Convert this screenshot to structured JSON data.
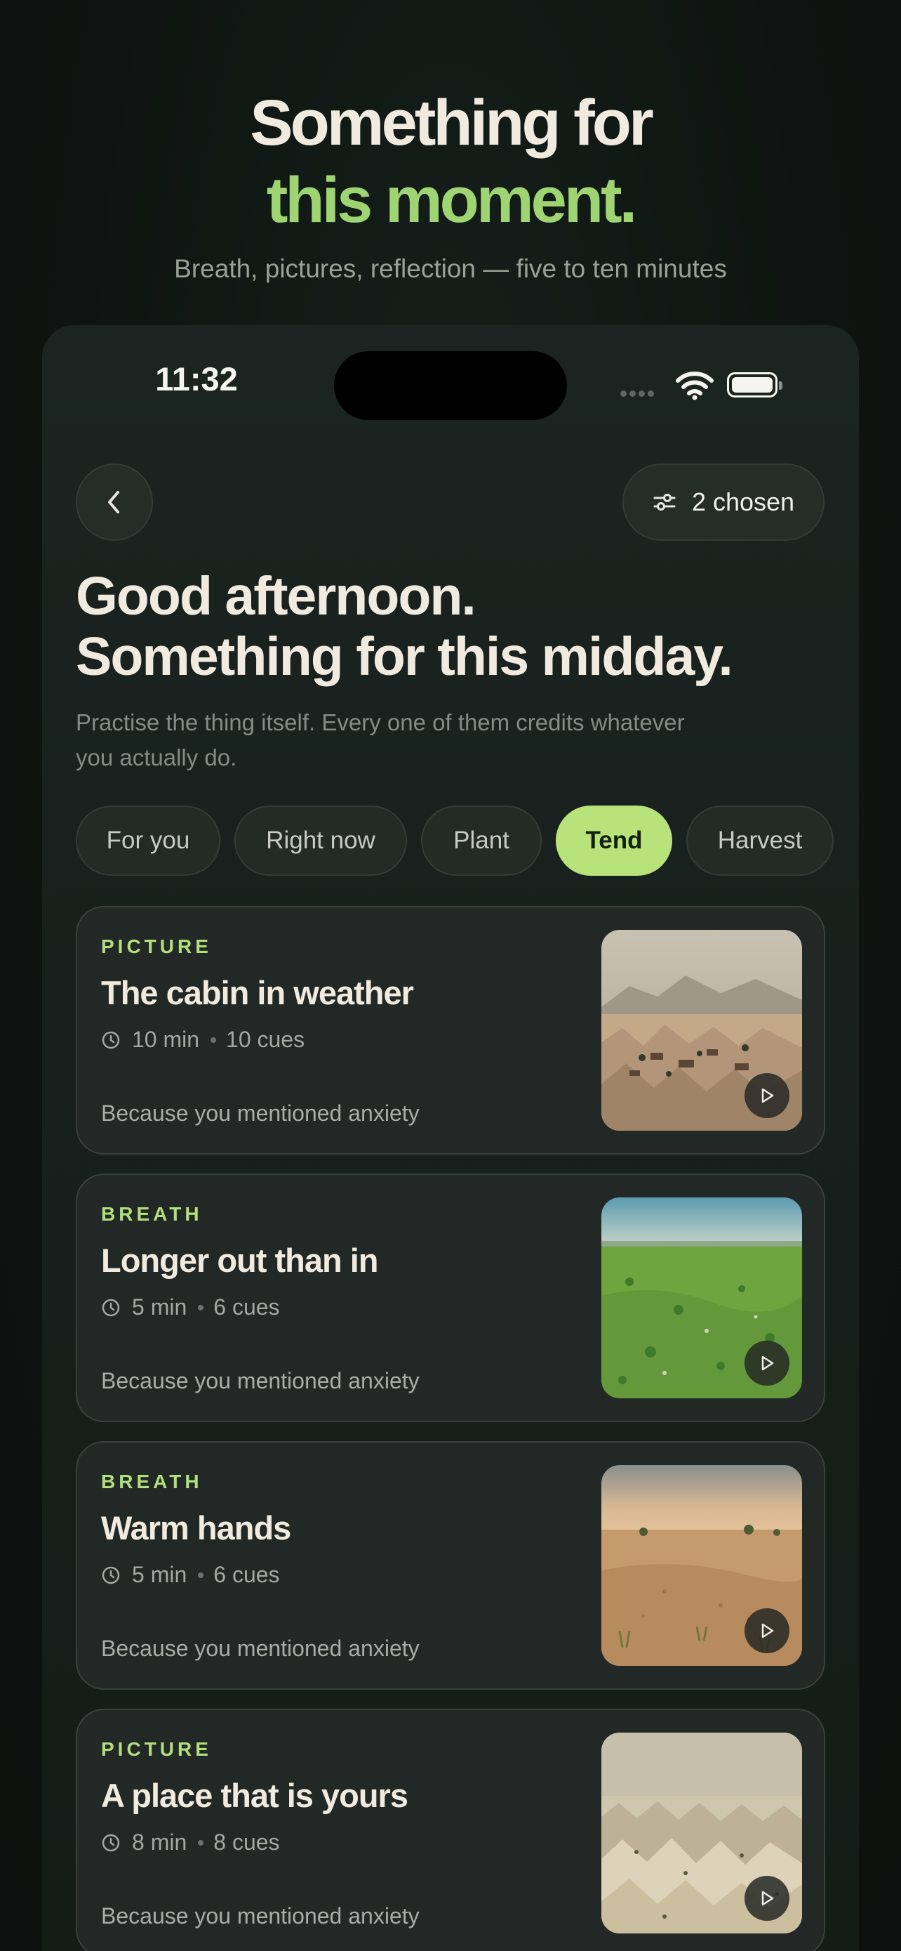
{
  "hero": {
    "title_line1": "Something for",
    "title_line2": "this moment.",
    "subtitle": "Breath, pictures, reflection — five to ten minutes"
  },
  "status_bar": {
    "time": "11:32"
  },
  "header": {
    "filter_label": "2 chosen",
    "greeting_line1": "Good afternoon.",
    "greeting_line2": "Something for this midday.",
    "intro": "Practise the thing itself. Every one of them credits whatever you actually do."
  },
  "chips": [
    {
      "label": "For you",
      "active": false
    },
    {
      "label": "Right now",
      "active": false
    },
    {
      "label": "Plant",
      "active": false
    },
    {
      "label": "Tend",
      "active": true
    },
    {
      "label": "Harvest",
      "active": false
    }
  ],
  "cards": [
    {
      "category": "PICTURE",
      "title": "The cabin in weather",
      "duration": "10 min",
      "cues": "10 cues",
      "reason": "Because you mentioned anxiety",
      "image": "desert-village-thumbnail"
    },
    {
      "category": "BREATH",
      "title": "Longer out than in",
      "duration": "5 min",
      "cues": "6 cues",
      "reason": "Because you mentioned anxiety",
      "image": "green-meadow-thumbnail"
    },
    {
      "category": "BREATH",
      "title": "Warm hands",
      "duration": "5 min",
      "cues": "6 cues",
      "reason": "Because you mentioned anxiety",
      "image": "sunset-desert-thumbnail"
    },
    {
      "category": "PICTURE",
      "title": "A place that is yours",
      "duration": "8 min",
      "cues": "8 cues",
      "reason": "Because you mentioned anxiety",
      "image": "pale-dunes-thumbnail"
    }
  ],
  "colors": {
    "accent": "#b8e27a",
    "hero_accent": "#9fd472",
    "background": "#0d1411",
    "card": "#222825"
  },
  "icons": [
    "back-chevron-icon",
    "sliders-icon",
    "wifi-icon",
    "battery-icon",
    "clock-icon",
    "play-icon"
  ]
}
